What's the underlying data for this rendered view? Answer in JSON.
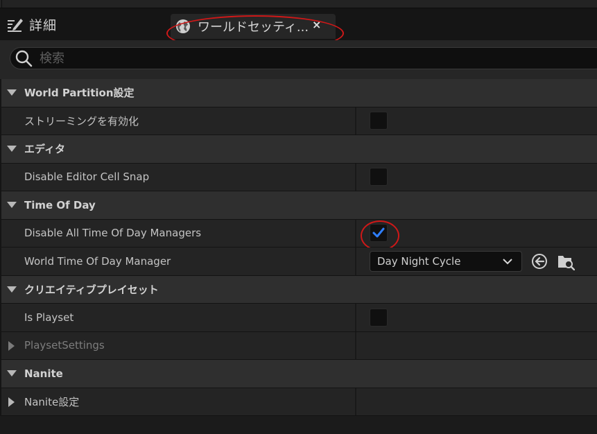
{
  "tabs": {
    "details_label": "詳細",
    "world_settings_label": "ワールドセッティ...",
    "close_glyph": "×"
  },
  "search": {
    "placeholder": "検索"
  },
  "sections": {
    "world_partition": {
      "title": "World Partition設定",
      "streaming_label": "ストリーミングを有効化",
      "streaming_checked": false
    },
    "editor": {
      "title": "エディタ",
      "disable_cell_snap_label": "Disable Editor Cell Snap",
      "disable_cell_snap_checked": false
    },
    "time_of_day": {
      "title": "Time Of Day",
      "disable_all_label": "Disable All Time Of Day Managers",
      "disable_all_checked": true,
      "manager_label": "World Time Of Day Manager",
      "manager_value": "Day Night Cycle"
    },
    "creative_playset": {
      "title": "クリエイティブプレイセット",
      "is_playset_label": "Is Playset",
      "is_playset_checked": false,
      "playset_settings_label": "PlaysetSettings"
    },
    "nanite": {
      "title": "Nanite",
      "settings_label": "Nanite設定"
    }
  },
  "colors": {
    "highlight": "#d01818",
    "check": "#2f7fff"
  }
}
